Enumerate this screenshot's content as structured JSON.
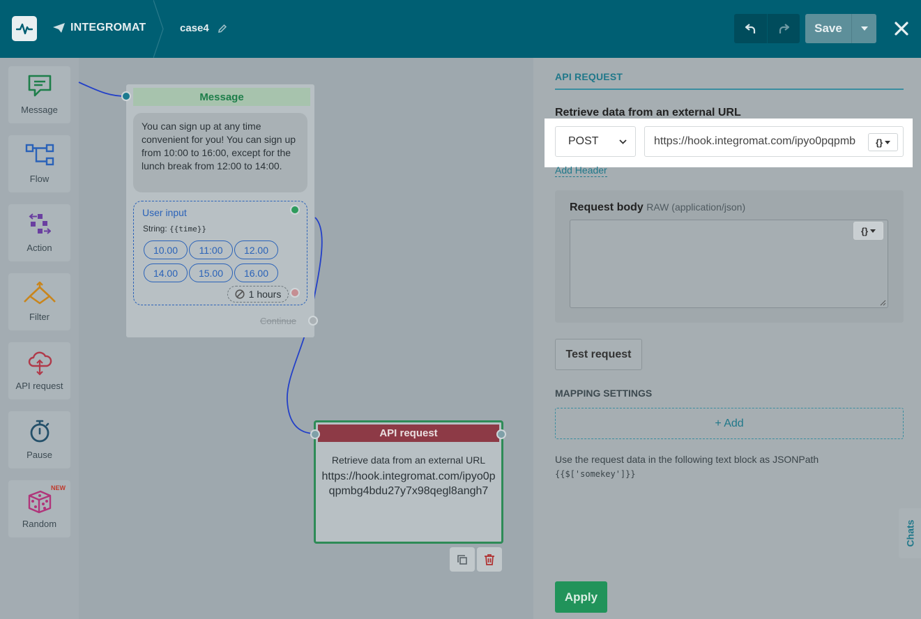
{
  "header": {
    "brand": "INTEGROMAT",
    "scenario_name": "case4",
    "save_label": "Save"
  },
  "palette": [
    {
      "label": "Message",
      "icon": "message-icon"
    },
    {
      "label": "Flow",
      "icon": "flow-icon"
    },
    {
      "label": "Action",
      "icon": "action-icon"
    },
    {
      "label": "Filter",
      "icon": "filter-icon"
    },
    {
      "label": "API request",
      "icon": "cloud-icon"
    },
    {
      "label": "Pause",
      "icon": "stopwatch-icon"
    },
    {
      "label": "Random",
      "icon": "dice-icon",
      "badge": "NEW"
    }
  ],
  "message_node": {
    "title": "Message",
    "text": "You can sign up at any time convenient for you! You can sign up from 10:00 to 16:00, except for the lunch break from 12:00 to 14:00.",
    "user_input": {
      "title": "User input",
      "type_label": "String:",
      "type_var": "{{time}}",
      "options": [
        "10.00",
        "11:00",
        "12.00",
        "14.00",
        "15.00",
        "16.00"
      ],
      "timeout": "1 hours"
    },
    "continue_label": "Continue"
  },
  "api_node": {
    "title": "API request",
    "description": "Retrieve data from an external URL",
    "url": "https://hook.integromat.com/ipyo0pqpmbg4bdu27y7x98qegl8angh7"
  },
  "panel": {
    "section_title": "API REQUEST",
    "retrieve_label": "Retrieve data from an external URL",
    "method": "POST",
    "url_value": "https://hook.integromat.com/ipyo0pqpmb",
    "fn_label": "{}",
    "add_header": "Add Header",
    "request_body_label": "Request body",
    "request_body_format": "RAW (application/json)",
    "test_request": "Test request",
    "mapping_title": "MAPPING SETTINGS",
    "mapping_add": "+ Add",
    "hint_text": "Use the request data in the following text block as JSONPath",
    "hint_code": "{{$['somekey']}}",
    "apply": "Apply",
    "chats": "Chats"
  },
  "colors": {
    "header_bg": "#005f73",
    "accent": "#20788a",
    "success": "#21935a",
    "api_red": "#8d3a46",
    "link_blue": "#2a62b8"
  }
}
